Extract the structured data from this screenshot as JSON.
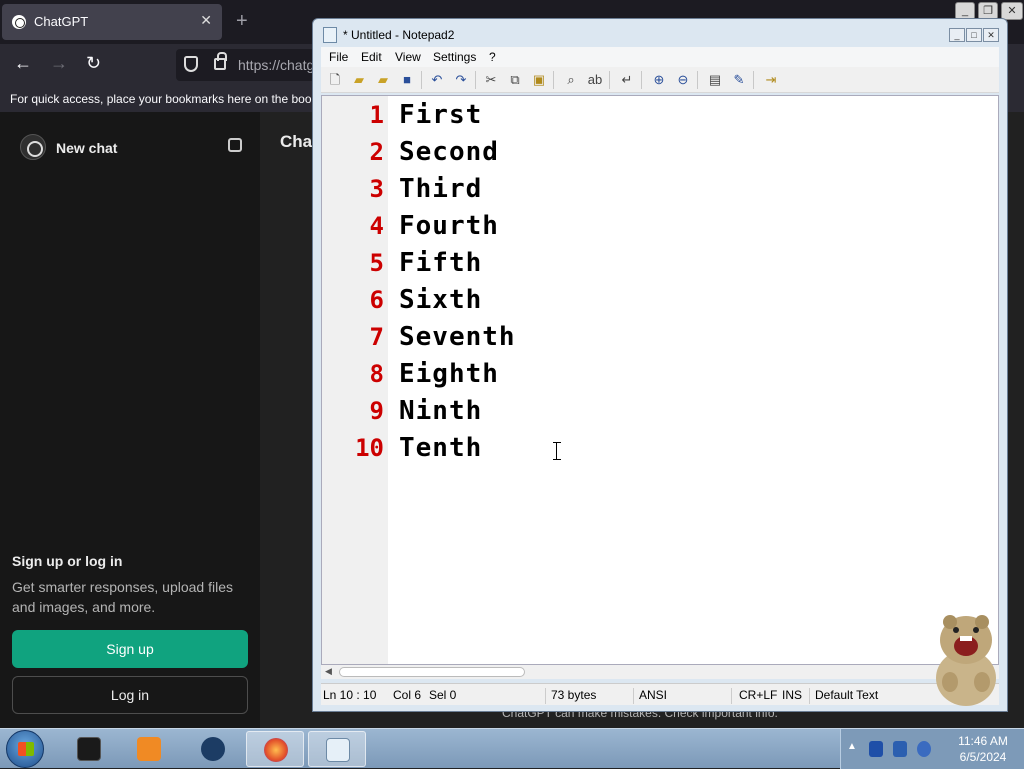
{
  "browser": {
    "tab_title": "ChatGPT",
    "tab_close": "✕",
    "new_tab": "+",
    "url": "https://chatg",
    "bookmarks_hint": "For quick access, place your bookmarks here on the book"
  },
  "chatgpt": {
    "new_chat_label": "New chat",
    "main_title": "Chat",
    "signin_heading": "Sign up or log in",
    "signin_sub": "Get smarter responses, upload files and images, and more.",
    "signup_label": "Sign up",
    "login_label": "Log in",
    "disclaimer": "ChatGPT can make mistakes. Check important info."
  },
  "notepad": {
    "title": "* Untitled - Notepad2",
    "menu": [
      "File",
      "Edit",
      "View",
      "Settings",
      "?"
    ],
    "lines": [
      {
        "num": "1",
        "text": "First"
      },
      {
        "num": "2",
        "text": "Second"
      },
      {
        "num": "3",
        "text": "Third"
      },
      {
        "num": "4",
        "text": "Fourth"
      },
      {
        "num": "5",
        "text": "Fifth"
      },
      {
        "num": "6",
        "text": "Sixth"
      },
      {
        "num": "7",
        "text": "Seventh"
      },
      {
        "num": "8",
        "text": "Eighth"
      },
      {
        "num": "9",
        "text": "Ninth"
      },
      {
        "num": "10",
        "text": "Tenth"
      }
    ],
    "status": {
      "position": "Ln 10 : 10",
      "col": "Col 6",
      "sel": "Sel 0",
      "size": "73 bytes",
      "encoding": "ANSI",
      "eol": "CR+LF",
      "ins": "INS",
      "scheme": "Default Text"
    }
  },
  "taskbar": {
    "time": "11:46 AM",
    "date": "6/5/2024"
  },
  "colors": {
    "line_number": "#cc0000",
    "signup_green": "#10a37f",
    "taskbar": "#8aa8c6"
  }
}
